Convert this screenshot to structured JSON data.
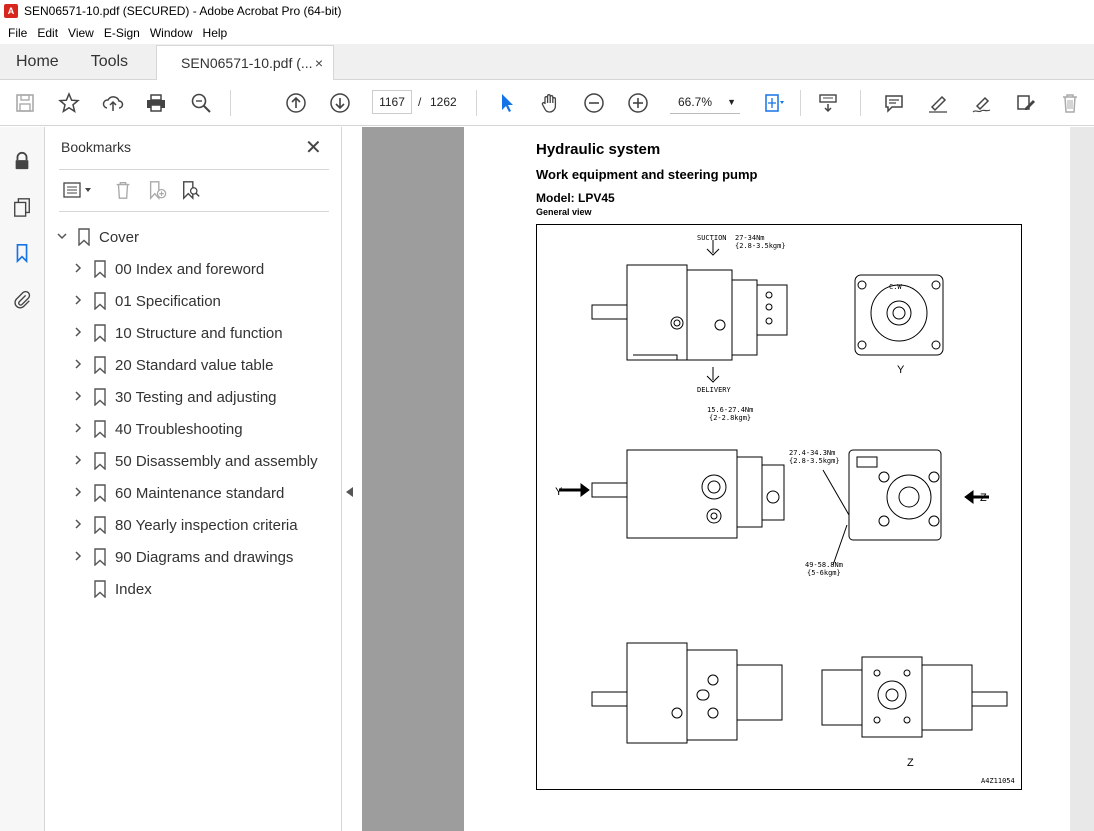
{
  "window": {
    "title": "SEN06571-10.pdf (SECURED) - Adobe Acrobat Pro (64-bit)",
    "app_icon_glyph": "A"
  },
  "menu": [
    "File",
    "Edit",
    "View",
    "E-Sign",
    "Window",
    "Help"
  ],
  "tabs": {
    "home": "Home",
    "tools": "Tools",
    "document": "SEN06571-10.pdf (...",
    "close_glyph": "×"
  },
  "toolbar": {
    "current_page": "1167",
    "page_separator": "/",
    "total_pages": "1262",
    "zoom": "66.7%",
    "zoom_caret": "▼"
  },
  "bookmarks": {
    "title": "Bookmarks",
    "close_glyph": "✕",
    "items": [
      {
        "label": "Cover",
        "level": 0,
        "expander": "expanded"
      },
      {
        "label": "00 Index and foreword",
        "level": 1,
        "expander": "collapsed"
      },
      {
        "label": "01 Specification",
        "level": 1,
        "expander": "collapsed"
      },
      {
        "label": "10 Structure and function",
        "level": 1,
        "expander": "collapsed"
      },
      {
        "label": "20 Standard value table",
        "level": 1,
        "expander": "collapsed"
      },
      {
        "label": "30 Testing and adjusting",
        "level": 1,
        "expander": "collapsed"
      },
      {
        "label": "40 Troubleshooting",
        "level": 1,
        "expander": "collapsed"
      },
      {
        "label": "50 Disassembly and assembly",
        "level": 1,
        "expander": "collapsed"
      },
      {
        "label": "60 Maintenance standard",
        "level": 1,
        "expander": "collapsed"
      },
      {
        "label": "80 Yearly inspection criteria",
        "level": 1,
        "expander": "collapsed"
      },
      {
        "label": "90 Diagrams and drawings",
        "level": 1,
        "expander": "collapsed"
      },
      {
        "label": "Index",
        "level": 1,
        "expander": "none"
      }
    ]
  },
  "document": {
    "heading": "Hydraulic system",
    "subheading": "Work equipment and steering pump",
    "model": "Model: LPV45",
    "caption": "General view",
    "figure_labels": {
      "suction": "SUCTION",
      "torque1": "27-34Nm",
      "torque1b": "{2.8-3.5kgm}",
      "delivery": "DELIVERY",
      "cw": "C.W",
      "y_label": "Y",
      "torque2": "15.6-27.4Nm",
      "torque2b": "{2-2.8kgm}",
      "torque3": "27.4-34.3Nm",
      "torque3b": "{2.8-3.5kgm}",
      "torque4": "49-58.8Nm",
      "torque4b": "{5-6kgm}",
      "z_label": "Z",
      "figure_id": "A4Z11054"
    }
  },
  "colors": {
    "accent": "#1473e6",
    "doc_background": "#9d9d9d",
    "pdf_icon": "#d7261e"
  }
}
